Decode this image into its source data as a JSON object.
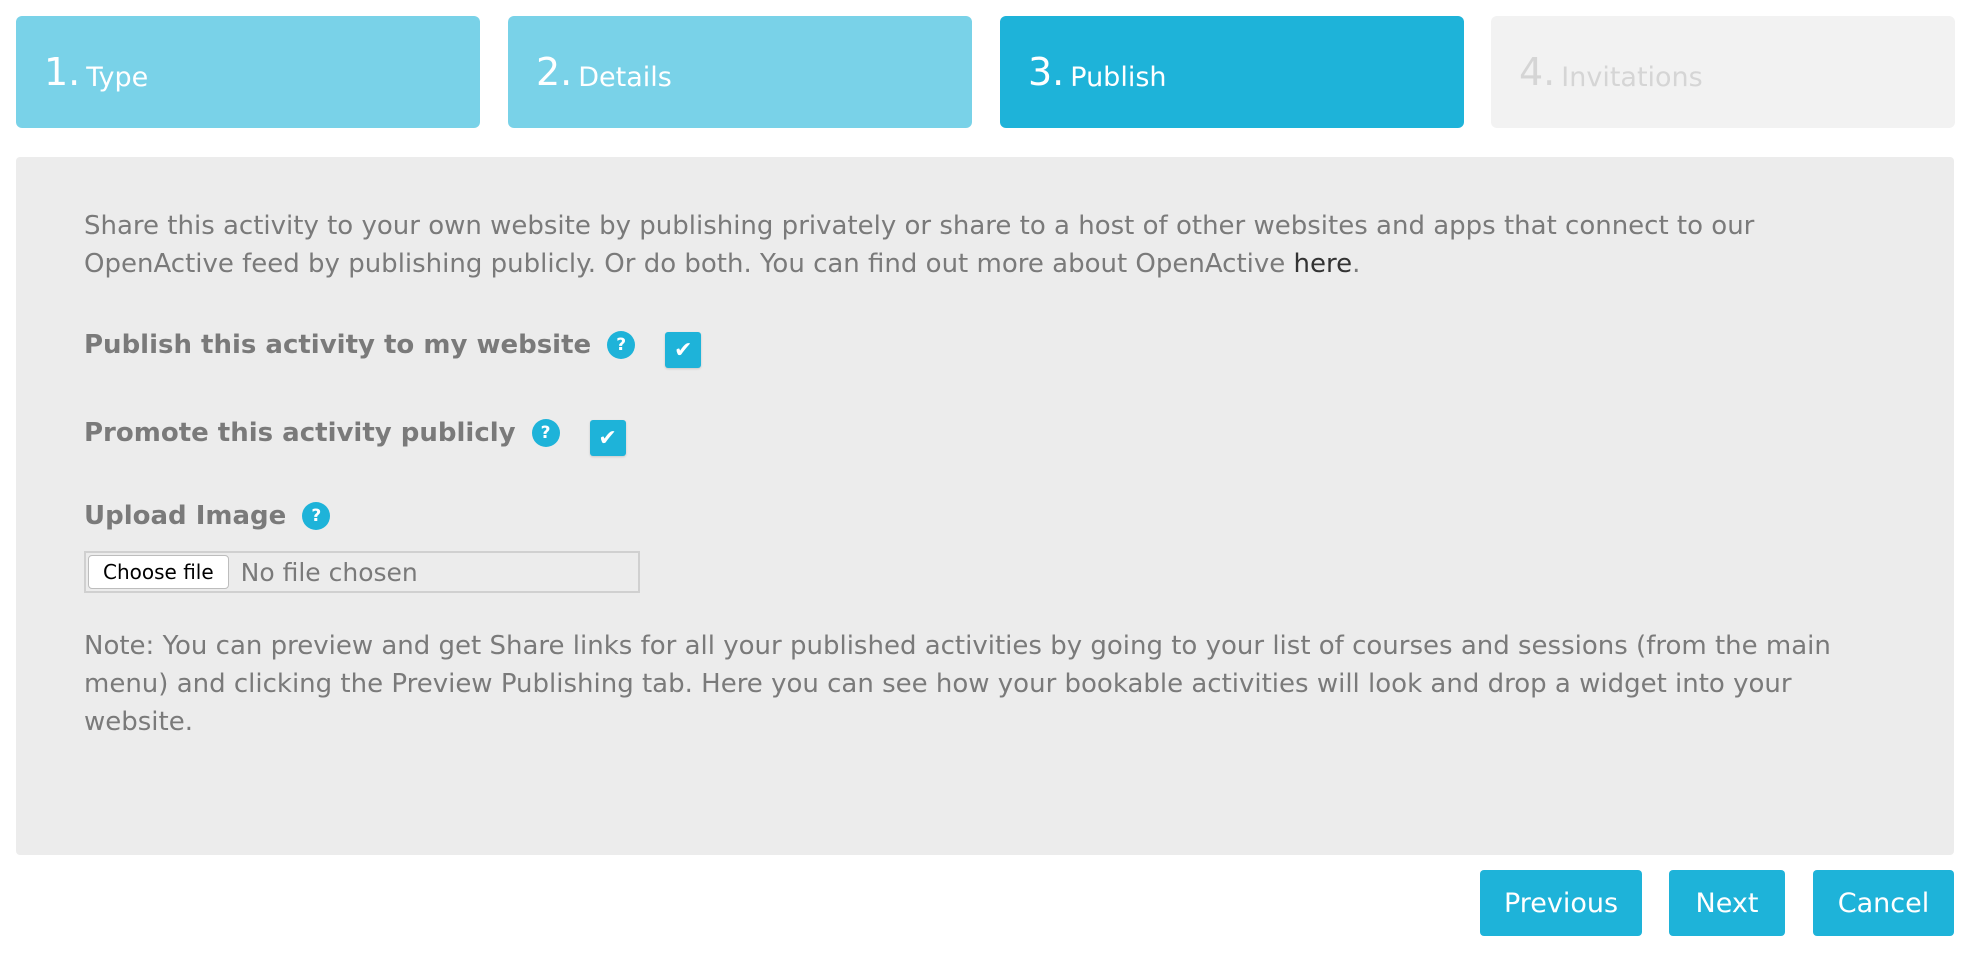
{
  "steps": [
    {
      "num": "1.",
      "label": "Type",
      "state": "done"
    },
    {
      "num": "2.",
      "label": "Details",
      "state": "done"
    },
    {
      "num": "3.",
      "label": "Publish",
      "state": "active"
    },
    {
      "num": "4.",
      "label": "Invitations",
      "state": "future"
    }
  ],
  "intro": {
    "text": "Share this activity to your own website by publishing privately or share to a host of other websites and apps that connect to our OpenActive feed by publishing publicly. Or do both. You can find out more about OpenActive ",
    "link": "here",
    "end": "."
  },
  "fields": {
    "publish_website": {
      "label": "Publish this activity to my website",
      "checked": true
    },
    "promote_public": {
      "label": "Promote this activity publicly",
      "checked": true
    },
    "upload": {
      "label": "Upload Image",
      "button": "Choose file",
      "status": "No file chosen"
    }
  },
  "help_glyph": "?",
  "check_glyph": "✔",
  "note": "Note: You can preview and get Share links for all your published activities by going to your list of courses and sessions (from the main menu) and clicking the Preview Publishing tab. Here you can see how your bookable activities will look and drop a widget into your website.",
  "buttons": {
    "previous": "Previous",
    "next": "Next",
    "cancel": "Cancel"
  },
  "colors": {
    "accent": "#1eb3d9",
    "done": "#79d2e8",
    "future": "#f2f2f2",
    "panel": "#ececec"
  }
}
